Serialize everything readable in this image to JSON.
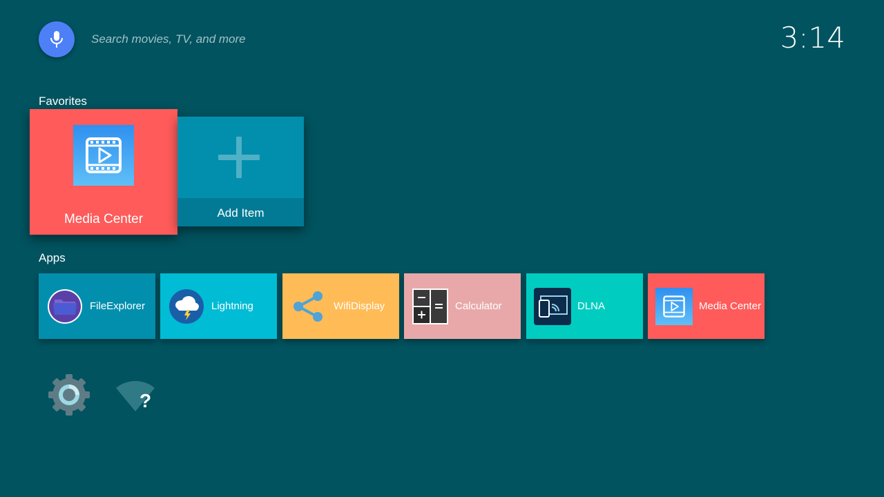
{
  "search": {
    "hint": "Search movies, TV, and more",
    "mic_color": "#4d80f7"
  },
  "clock": "3:14",
  "favorites": {
    "title": "Favorites",
    "items": [
      {
        "label": "Media Center",
        "icon": "media-center-icon",
        "color": "#fe5b5a",
        "focused": true
      },
      {
        "label": "Add Item",
        "icon": "plus-icon",
        "color": "#028fae"
      }
    ]
  },
  "apps": {
    "title": "Apps",
    "items": [
      {
        "label": "FileExplorer",
        "icon": "folder-icon",
        "color": "#028fae"
      },
      {
        "label": "Lightning",
        "icon": "storm-cloud-icon",
        "color": "#00bcd4"
      },
      {
        "label": "WifiDisplay",
        "icon": "share-icon",
        "color": "#ffbb56"
      },
      {
        "label": "Calculator",
        "icon": "calculator-icon",
        "color": "#e8a8a9"
      },
      {
        "label": "DLNA",
        "icon": "cast-icon",
        "color": "#00cdc0"
      },
      {
        "label": "Media Center",
        "icon": "media-center-icon",
        "color": "#fe5b5a"
      }
    ]
  },
  "system": [
    {
      "icon": "settings-gear-icon"
    },
    {
      "icon": "wifi-unknown-icon"
    }
  ],
  "colors": {
    "background": "#00535f",
    "accent": "#fe5b5a"
  }
}
